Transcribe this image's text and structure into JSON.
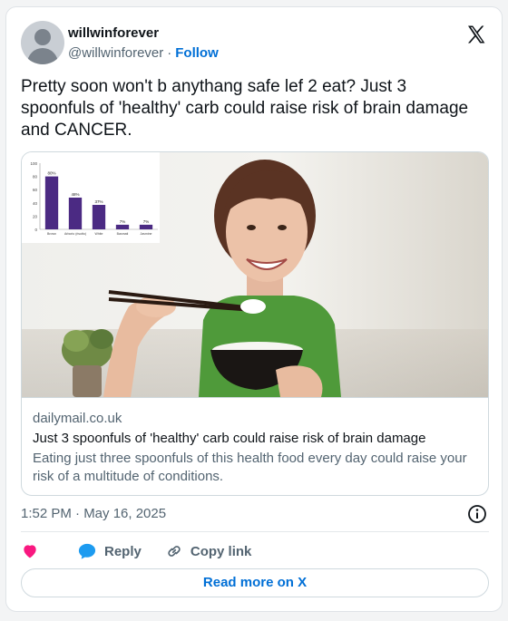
{
  "author": {
    "name": "willwinforever",
    "handle": "@willwinforever",
    "separator": "·",
    "follow_label": "Follow"
  },
  "tweet": {
    "text": "Pretty soon won't b anythang safe lef 2 eat? Just 3 spoonfuls of 'healthy' carb could raise risk of brain damage and CANCER.",
    "timestamp": "1:52 PM · May 16, 2025"
  },
  "link_card": {
    "domain": "dailymail.co.uk",
    "title": "Just 3 spoonfuls of 'healthy' carb could raise risk of brain damage",
    "description": "Eating just three spoonfuls of this health food every day could raise your risk of a multitude of conditions.",
    "inset_chart": {
      "type": "bar",
      "values_labels": [
        "80%",
        "48%",
        "37%",
        "7%",
        "7%"
      ],
      "values": [
        80,
        48,
        37,
        7,
        7
      ],
      "categories": [
        "Brown",
        "Arborio (risotto)",
        "White",
        "Basmati",
        "Jasmine"
      ],
      "yticks": [
        "100",
        "80",
        "60",
        "40",
        "20",
        "0"
      ],
      "ylim": [
        0,
        100
      ],
      "color": "#4b2a83"
    }
  },
  "actions": {
    "reply_label": "Reply",
    "copy_label": "Copy link",
    "read_more_label": "Read more on X"
  },
  "colors": {
    "accent": "#006fd6",
    "heart": "#f91880",
    "reply": "#1d9bf0",
    "secondary_text": "#536471"
  },
  "icons": {
    "logo": "x-logo-icon",
    "info": "info-icon",
    "like": "heart-icon",
    "reply": "speech-bubble-icon",
    "copy": "link-icon"
  }
}
